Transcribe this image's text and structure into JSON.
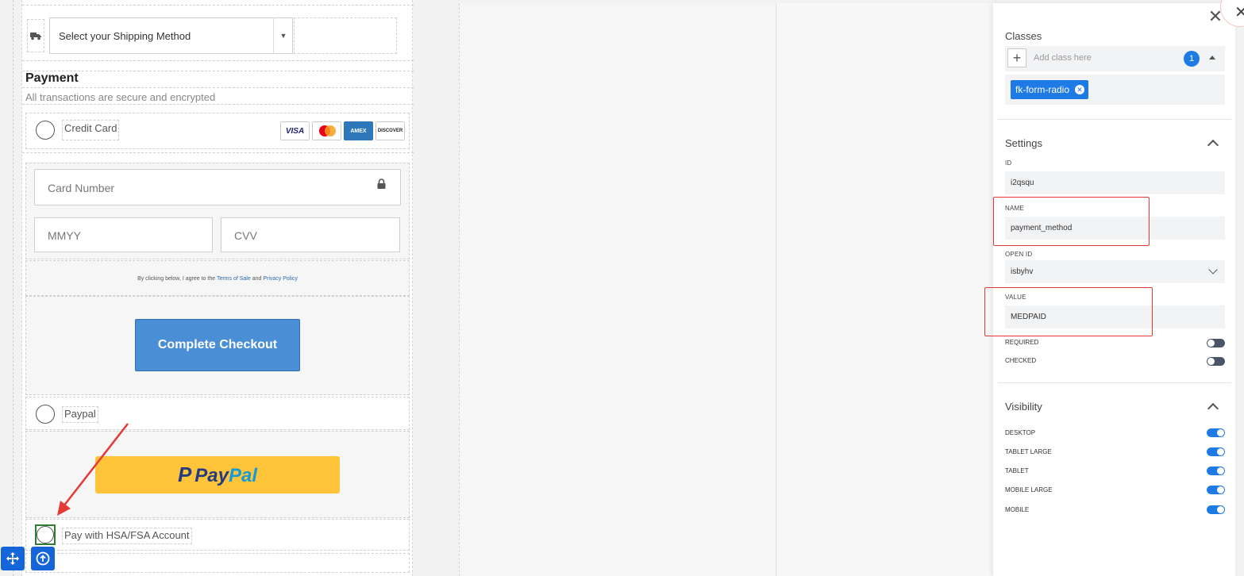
{
  "shipping": {
    "placeholder": "Select your Shipping Method"
  },
  "payment": {
    "title": "Payment",
    "subtitle": "All transactions are secure and encrypted",
    "options": [
      {
        "label": "Credit Card"
      },
      {
        "label": "Paypal"
      },
      {
        "label": "Pay with HSA/FSA Account"
      }
    ],
    "card_brands": [
      "VISA",
      "MasterCard",
      "AMEX",
      "DISCOVER"
    ],
    "card_number_placeholder": "Card Number",
    "expiry_placeholder": "MMYY",
    "cvv_placeholder": "CVV",
    "terms": {
      "prefix": "By clicking below, I agree to the",
      "terms_link": "Terms of Sale",
      "and": "and",
      "privacy_link": "Privacy Policy"
    },
    "checkout_label": "Complete Checkout",
    "paypal": {
      "pay": "Pay",
      "pal": "Pal",
      "mark": "P"
    }
  },
  "panel": {
    "classes_header": "Classes",
    "add_class_placeholder": "Add class here",
    "class_count": "1",
    "class_tag": "fk-form-radio",
    "settings_header": "Settings",
    "fields": {
      "id_label": "ID",
      "id_value": "i2qsqu",
      "name_label": "NAME",
      "name_value": "payment_method",
      "open_id_label": "OPEN ID",
      "open_id_value": "isbyhv",
      "value_label": "VALUE",
      "value_value": "MEDPAID"
    },
    "toggles": [
      {
        "label": "REQUIRED",
        "on": false
      },
      {
        "label": "CHECKED",
        "on": false
      }
    ],
    "visibility_header": "Visibility",
    "visibility": [
      {
        "label": "DESKTOP",
        "on": true
      },
      {
        "label": "TABLET LARGE",
        "on": true
      },
      {
        "label": "TABLET",
        "on": true
      },
      {
        "label": "MOBILE LARGE",
        "on": true
      },
      {
        "label": "MOBILE",
        "on": true
      }
    ]
  },
  "colors": {
    "accent": "#1e7be6",
    "highlight": "#e53935",
    "checkout": "#4a8fd6",
    "paypal": "#ffc439"
  }
}
